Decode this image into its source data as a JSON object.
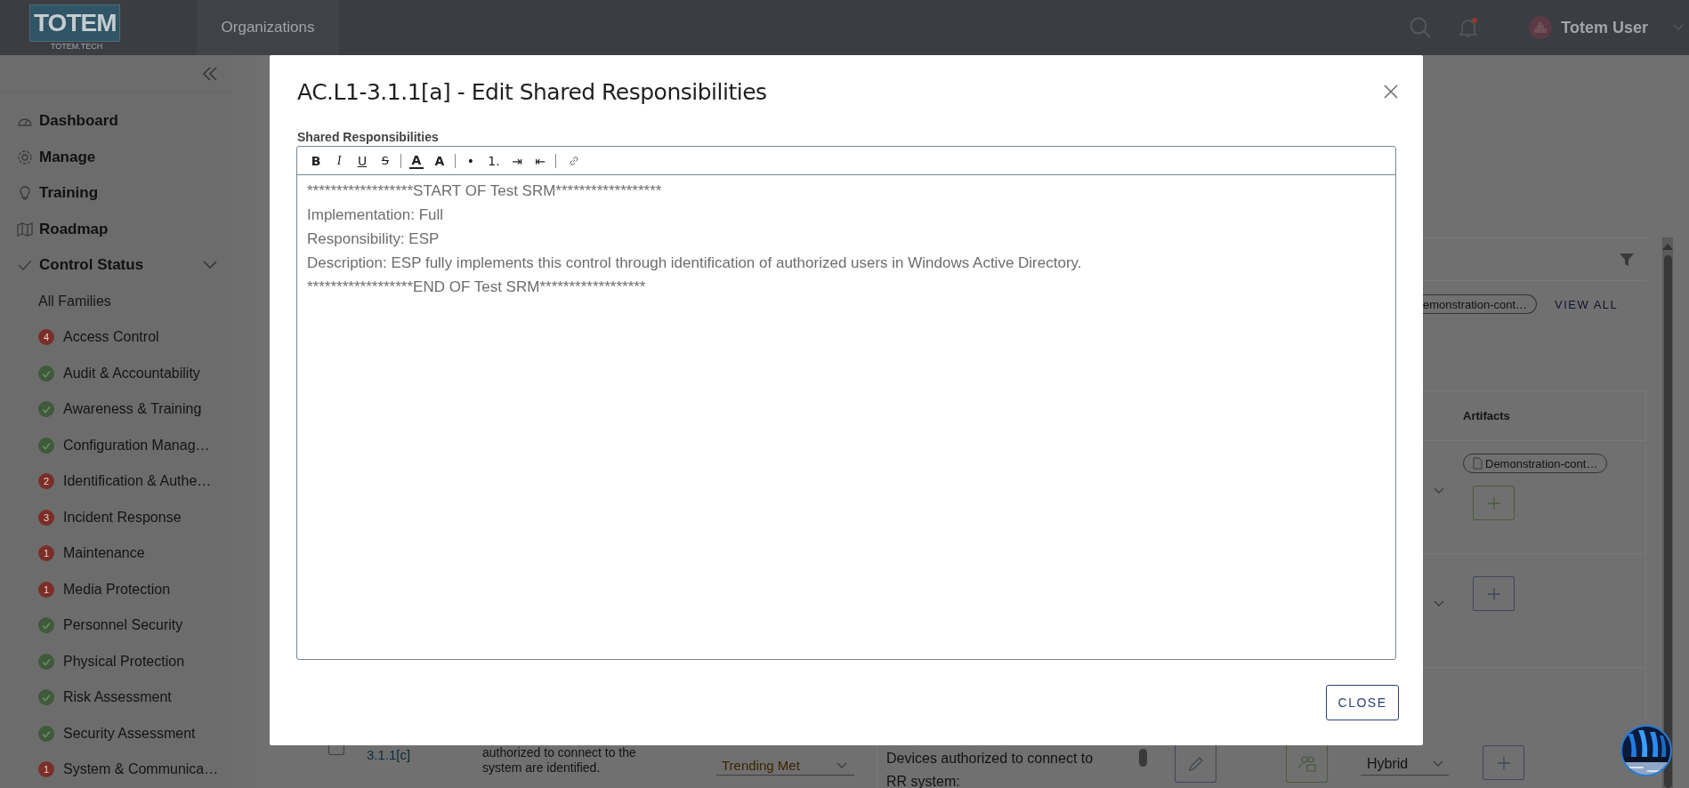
{
  "topbar": {
    "logo": "TOTEM",
    "logo_tagline": "TOTEM.TECH",
    "nav": [
      {
        "label": "Organizations"
      }
    ],
    "notifications": true,
    "user": "Totem User"
  },
  "sidebar": {
    "items": [
      {
        "label": "Dashboard"
      },
      {
        "label": "Manage"
      },
      {
        "label": "Training"
      },
      {
        "label": "Roadmap"
      },
      {
        "label": "Control Status",
        "expanded": true,
        "children": [
          {
            "label": "All Families",
            "kind": "all"
          },
          {
            "label": "Access Control",
            "kind": "issues",
            "count": "4"
          },
          {
            "label": "Audit & Accountability",
            "kind": "met"
          },
          {
            "label": "Awareness & Training",
            "kind": "met"
          },
          {
            "label": "Configuration Manag…",
            "kind": "met"
          },
          {
            "label": "Identification & Authe…",
            "kind": "issues",
            "count": "2"
          },
          {
            "label": "Incident Response",
            "kind": "issues",
            "count": "3"
          },
          {
            "label": "Maintenance",
            "kind": "issues",
            "count": "1"
          },
          {
            "label": "Media Protection",
            "kind": "issues",
            "count": "1"
          },
          {
            "label": "Personnel Security",
            "kind": "met"
          },
          {
            "label": "Physical Protection",
            "kind": "met"
          },
          {
            "label": "Risk Assessment",
            "kind": "met"
          },
          {
            "label": "Security Assessment",
            "kind": "met"
          },
          {
            "label": "System & Communica…",
            "kind": "issues",
            "count": "1"
          }
        ]
      }
    ]
  },
  "filter_panel": {
    "chips": [
      "emonstration-cont…"
    ],
    "view_all": "VIEW ALL"
  },
  "table": {
    "artifacts_header": "Artifacts",
    "artifact_rows": [
      {
        "kind": "chip",
        "chip": "Demonstration-cont…"
      },
      {
        "kind": "empty"
      }
    ],
    "bottom_row": {
      "checked": false,
      "id": "3.1.1[c]",
      "requirement": "authorized to connect to the system are identified.",
      "status": "Trending Met",
      "description": "Devices authorized to connect to RR system:",
      "responsibility": "Hybrid"
    }
  },
  "modal": {
    "title": "AC.L1-3.1.1[a] - Edit Shared Responsibilities",
    "field_label": "Shared Responsibilities",
    "toolbar": [
      {
        "kind": "bold",
        "label": "B"
      },
      {
        "kind": "italic",
        "label": "I"
      },
      {
        "kind": "underline",
        "label": "U"
      },
      {
        "kind": "strike",
        "label": "S"
      },
      {
        "kind": "separator"
      },
      {
        "kind": "color",
        "label": "A"
      },
      {
        "kind": "highlight",
        "label": "A"
      },
      {
        "kind": "separator"
      },
      {
        "kind": "bullet",
        "label": "•"
      },
      {
        "kind": "number",
        "label": "1."
      },
      {
        "kind": "indent",
        "label": "⇥"
      },
      {
        "kind": "outdent",
        "label": "⇤"
      },
      {
        "kind": "separator"
      },
      {
        "kind": "link"
      }
    ],
    "lines": [
      "******************START OF Test SRM******************",
      "Implementation: Full",
      "Responsibility: ESP",
      "Description: ESP fully implements this control through identification of authorized users in Windows Active Directory.",
      "******************END OF Test SRM******************"
    ],
    "close_label": "CLOSE"
  }
}
